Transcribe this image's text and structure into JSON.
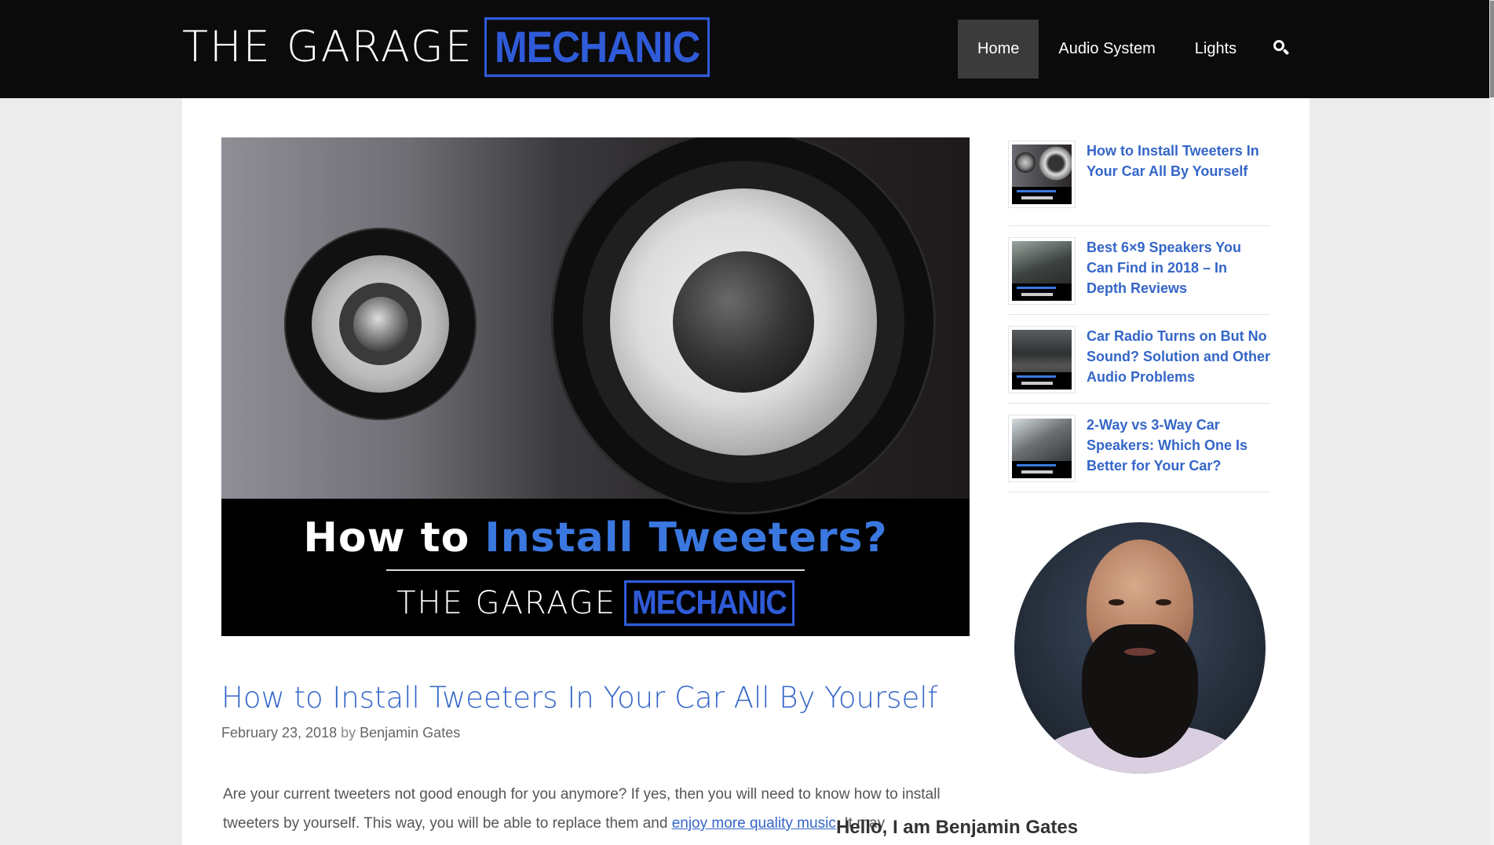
{
  "header": {
    "logo_text": "THE GARAGE",
    "logo_box": "MECHANIC",
    "nav": [
      {
        "label": "Home"
      },
      {
        "label": "Audio System"
      },
      {
        "label": "Lights"
      }
    ],
    "search_icon": "search-icon"
  },
  "hero": {
    "title_prefix": "How to ",
    "title_highlight": "Install Tweeters?",
    "logo_text": "THE GARAGE",
    "logo_box": "MECHANIC"
  },
  "post": {
    "title": "How to Install Tweeters In Your Car All By Yourself",
    "date": "February 23, 2018",
    "by": "by",
    "author": "Benjamin Gates",
    "body_part1": "Are your current tweeters not good enough for you anymore? If yes, then you will need to know how to install tweeters by yourself. This way, you will be able to replace them and ",
    "body_link": "enjoy more quality music",
    "body_part2": ". It may"
  },
  "sidebar": {
    "recent_posts": [
      {
        "title": "How to Install Tweeters In Your Car All By Yourself"
      },
      {
        "title": "Best 6×9 Speakers You Can Find in 2018 – In Depth Reviews"
      },
      {
        "title": "Car Radio Turns on But No Sound? Solution and Other Audio Problems"
      },
      {
        "title": "2-Way vs 3-Way Car Speakers: Which One Is Better for Your Car?"
      }
    ],
    "author_heading": "Hello, I am Benjamin Gates"
  },
  "colors": {
    "accent": "#3466c8",
    "header_bg": "#0b0b0b",
    "nav_active_bg": "#3b3b3b"
  }
}
